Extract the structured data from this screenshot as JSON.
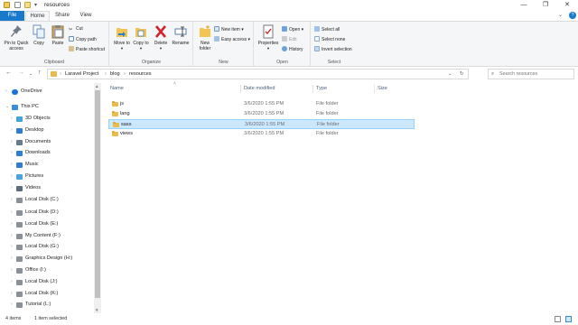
{
  "window": {
    "title": "resources",
    "controls": {
      "minimize": "—",
      "maximize": "❐",
      "close": "✕"
    },
    "help": "?"
  },
  "ribbon_tabs": {
    "file": "File",
    "home": "Home",
    "share": "Share",
    "view": "View"
  },
  "ribbon": {
    "clipboard": {
      "label": "Clipboard",
      "pin": "Pin to Quick access",
      "copy": "Copy",
      "paste": "Paste",
      "cut": "Cut",
      "copy_path": "Copy path",
      "paste_shortcut": "Paste shortcut"
    },
    "organize": {
      "label": "Organize",
      "move_to": "Move to",
      "copy_to": "Copy to",
      "delete": "Delete",
      "rename": "Rename"
    },
    "new": {
      "label": "New",
      "new_folder": "New folder",
      "new_item": "New item",
      "easy_access": "Easy access"
    },
    "open": {
      "label": "Open",
      "properties": "Properties",
      "open": "Open",
      "edit": "Edit",
      "history": "History"
    },
    "select": {
      "label": "Select",
      "select_all": "Select all",
      "select_none": "Select none",
      "invert_selection": "Invert selection"
    }
  },
  "address": {
    "crumbs": [
      "Laravel Project",
      "blog",
      "resources"
    ],
    "search_placeholder": "Search resources"
  },
  "nav_pane": [
    {
      "label": "OneDrive",
      "icon": "cloud-icon",
      "color": "#1a73d9"
    },
    {
      "label": "This PC",
      "icon": "computer-icon",
      "color": "#3b8fd9"
    },
    {
      "label": "3D Objects",
      "icon": "cube-icon",
      "color": "#42a5d8"
    },
    {
      "label": "Desktop",
      "icon": "desktop-icon",
      "color": "#2f7fd0"
    },
    {
      "label": "Documents",
      "icon": "document-icon",
      "color": "#6a7b8c"
    },
    {
      "label": "Downloads",
      "icon": "download-icon",
      "color": "#2f7fd0"
    },
    {
      "label": "Music",
      "icon": "music-icon",
      "color": "#2f7fd0"
    },
    {
      "label": "Pictures",
      "icon": "picture-icon",
      "color": "#4aa3df"
    },
    {
      "label": "Videos",
      "icon": "video-icon",
      "color": "#5b6c7c"
    },
    {
      "label": "Local Disk (C:)",
      "icon": "disk-icon",
      "color": "#8a9097"
    },
    {
      "label": "Local Disk (D:)",
      "icon": "disk-icon",
      "color": "#8a9097"
    },
    {
      "label": "Local Disk (E:)",
      "icon": "disk-icon",
      "color": "#8a9097"
    },
    {
      "label": "My Content (F:)",
      "icon": "disk-icon",
      "color": "#8a9097"
    },
    {
      "label": "Local Disk (G:)",
      "icon": "disk-icon",
      "color": "#8a9097"
    },
    {
      "label": "Graphics Design (H:)",
      "icon": "disk-icon",
      "color": "#8a9097"
    },
    {
      "label": "Office (I:)",
      "icon": "disk-icon",
      "color": "#8a9097"
    },
    {
      "label": "Local Disk (J:)",
      "icon": "disk-icon",
      "color": "#8a9097"
    },
    {
      "label": "Local Disk (K:)",
      "icon": "disk-icon",
      "color": "#8a9097"
    },
    {
      "label": "Tutorial (L:)",
      "icon": "disk-icon",
      "color": "#8a9097"
    }
  ],
  "columns": {
    "name": "Name",
    "date": "Date modified",
    "type": "Type",
    "size": "Size"
  },
  "files": [
    {
      "name": "js",
      "date": "3/6/2020 1:55 PM",
      "type": "File folder",
      "size": ""
    },
    {
      "name": "lang",
      "date": "3/6/2020 1:55 PM",
      "type": "File folder",
      "size": ""
    },
    {
      "name": "sass",
      "date": "3/6/2020 1:55 PM",
      "type": "File folder",
      "size": "",
      "selected": true
    },
    {
      "name": "views",
      "date": "3/6/2020 1:55 PM",
      "type": "File folder",
      "size": ""
    }
  ],
  "status": {
    "count": "4 items",
    "selection": "1 item selected"
  },
  "colors": {
    "accent": "#1979ca",
    "selection": "#cce8ff",
    "folder": "#e8bb4a"
  }
}
